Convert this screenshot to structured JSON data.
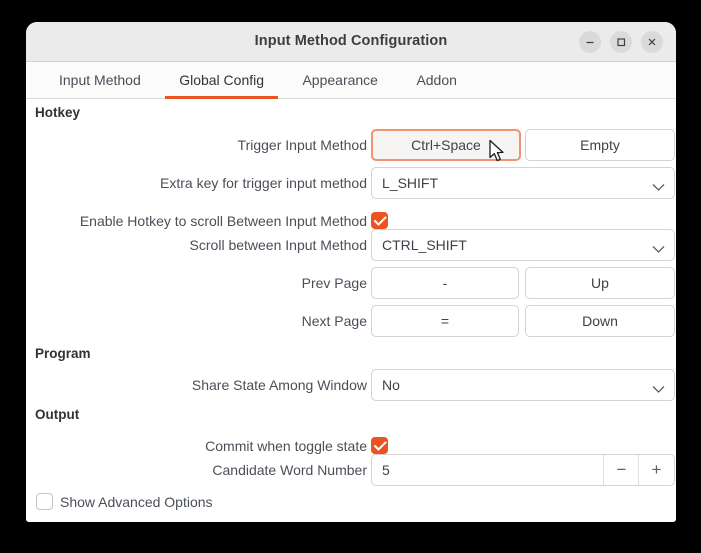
{
  "window": {
    "title": "Input Method Configuration",
    "controls": [
      {
        "name": "minimize",
        "glyph": "minimize-icon"
      },
      {
        "name": "maximize",
        "glyph": "maximize-icon"
      },
      {
        "name": "close",
        "glyph": "close-icon"
      }
    ]
  },
  "tabs": [
    {
      "label": "Input Method",
      "active": false
    },
    {
      "label": "Global Config",
      "active": true
    },
    {
      "label": "Appearance",
      "active": false
    },
    {
      "label": "Addon",
      "active": false
    }
  ],
  "sections": {
    "hotkey": {
      "title": "Hotkey"
    },
    "program": {
      "title": "Program"
    },
    "output": {
      "title": "Output"
    }
  },
  "rows": {
    "trigger_input_method": {
      "label": "Trigger Input Method",
      "button_primary": "Ctrl+Space",
      "button_secondary": "Empty"
    },
    "extra_key": {
      "label": "Extra key for trigger input method",
      "value": "L_SHIFT"
    },
    "enable_hotkey_scroll": {
      "label": "Enable Hotkey to scroll Between Input Method",
      "checked": true
    },
    "scroll_between": {
      "label": "Scroll between Input Method",
      "value": "CTRL_SHIFT"
    },
    "prev_page": {
      "label": "Prev Page",
      "button_primary": "-",
      "button_secondary": "Up"
    },
    "next_page": {
      "label": "Next Page",
      "button_primary": "=",
      "button_secondary": "Down"
    },
    "share_state": {
      "label": "Share State Among Window",
      "value": "No"
    },
    "commit_toggle": {
      "label": "Commit when toggle state",
      "checked": true
    },
    "candidate_word_number": {
      "label": "Candidate Word Number",
      "value": "5",
      "decrement": "−",
      "increment": "+"
    },
    "show_advanced": {
      "label": "Show Advanced Options",
      "checked": false
    }
  },
  "colors": {
    "accent": "#e95420",
    "focus_ring": "#ef9370",
    "titlebar": "#ebebeb",
    "text": "#4a4f58"
  }
}
